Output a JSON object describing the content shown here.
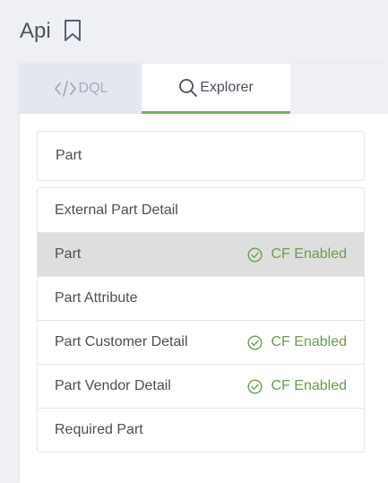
{
  "header": {
    "title": "Api"
  },
  "tabs": [
    {
      "label": "DQL",
      "icon": "code-icon",
      "active": false
    },
    {
      "label": "Explorer",
      "icon": "search-icon",
      "active": true
    }
  ],
  "search": {
    "value": "Part"
  },
  "results": [
    {
      "label": "External Part Detail",
      "badge": ""
    },
    {
      "label": "Part",
      "badge": "CF Enabled",
      "selected": true
    },
    {
      "label": "Part Attribute",
      "badge": ""
    },
    {
      "label": "Part Customer Detail",
      "badge": "CF Enabled"
    },
    {
      "label": "Part Vendor Detail",
      "badge": "CF Enabled"
    },
    {
      "label": "Required Part",
      "badge": ""
    }
  ],
  "colors": {
    "accent_green": "#7ab05c",
    "badge_green": "#6a9c4f",
    "selected_row": "#dedede",
    "background": "#eef0f5"
  }
}
